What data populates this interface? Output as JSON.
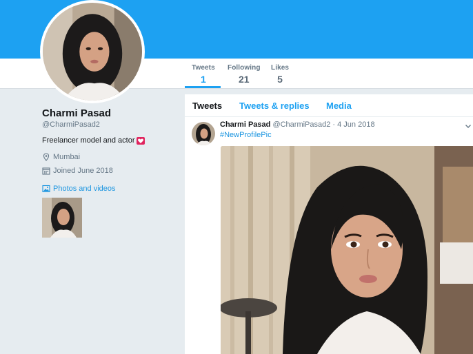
{
  "profile": {
    "name": "Charmi Pasad",
    "handle": "@CharmiPasad2",
    "bio": "Freelancer model and actor",
    "location": "Mumbai",
    "joined": "Joined June 2018",
    "photos_link": "Photos and videos"
  },
  "stats": [
    {
      "label": "Tweets",
      "value": "1"
    },
    {
      "label": "Following",
      "value": "21"
    },
    {
      "label": "Likes",
      "value": "5"
    }
  ],
  "tabs": [
    {
      "label": "Tweets"
    },
    {
      "label": "Tweets & replies"
    },
    {
      "label": "Media"
    }
  ],
  "tweet": {
    "name": "Charmi Pasad",
    "handle_date": "@CharmiPasad2 · 4 Jun 2018",
    "hashtag": "#NewProfilePic"
  },
  "colors": {
    "brand": "#1da1f2",
    "link": "#1b95e0",
    "heart": "#e0245e"
  },
  "icons": [
    "location-pin-icon",
    "calendar-icon",
    "photo-icon",
    "heart-icon",
    "chevron-down-icon"
  ]
}
